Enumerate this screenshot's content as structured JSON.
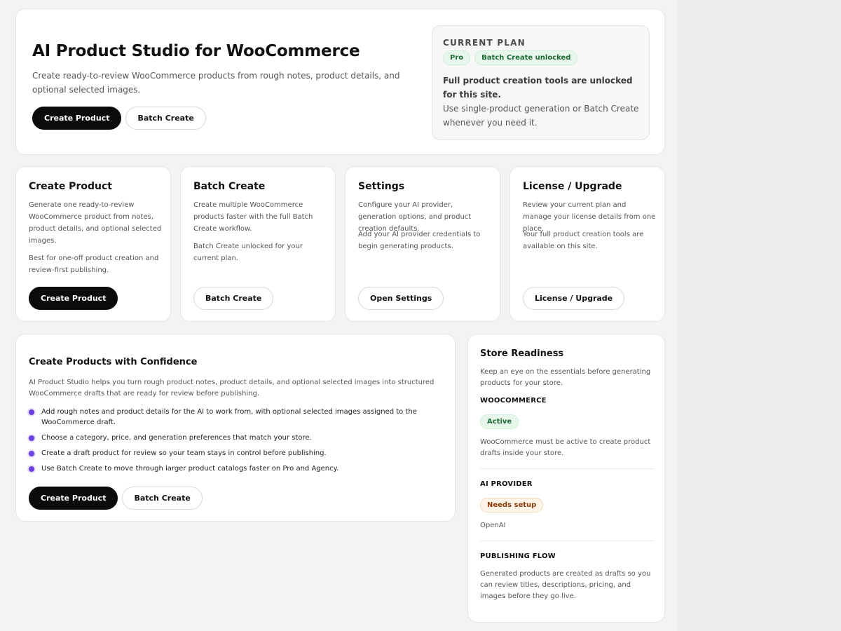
{
  "hero": {
    "title": "AI Product Studio for WooCommerce",
    "description": "Create ready-to-review WooCommerce products from rough notes, product details, and optional selected images.",
    "primary_label": "Create Product",
    "secondary_label": "Batch Create"
  },
  "plan": {
    "label": "CURRENT PLAN",
    "badges": [
      "Pro",
      "Batch Create unlocked"
    ],
    "headline": "Full product creation tools are unlocked for this site.",
    "text": "Use single-product generation or Batch Create whenever you need it."
  },
  "cards": [
    {
      "title": "Create Product",
      "description": "Generate one ready-to-review WooCommerce product from notes, product details, and optional selected images.",
      "note": "Best for one-off product creation and review-first publishing.",
      "button": "Create Product"
    },
    {
      "title": "Batch Create",
      "description": "Create multiple WooCommerce products faster with the full Batch Create workflow.",
      "note": "Batch Create unlocked for your current plan.",
      "button": "Batch Create"
    },
    {
      "title": "Settings",
      "description": "Configure your AI provider, generation options, and product creation defaults.",
      "note": "Add your AI provider credentials to begin generating products.",
      "button": "Open Settings"
    },
    {
      "title": "License / Upgrade",
      "description": "Review your current plan and manage your license details from one place.",
      "note": "Your full product creation tools are available on this site.",
      "button": "License / Upgrade"
    }
  ],
  "confidence": {
    "title": "Create Products with Confidence",
    "description": "AI Product Studio helps you turn rough product notes, product details, and optional selected images into structured WooCommerce drafts that are ready for review before publishing.",
    "items": [
      "Add rough notes and product details for the AI to work from, with optional selected images assigned to the WooCommerce draft.",
      "Choose a category, price, and generation preferences that match your store.",
      "Create a draft product for review so your team stays in control before publishing.",
      "Use Batch Create to move through larger product catalogs faster on Pro and Agency."
    ],
    "primary_label": "Create Product",
    "secondary_label": "Batch Create"
  },
  "readiness": {
    "title": "Store Readiness",
    "description": "Keep an eye on the essentials before generating products for your store.",
    "woocommerce": {
      "heading": "WOOCOMMERCE",
      "status": "Active",
      "text": "WooCommerce must be active to create product drafts inside your store."
    },
    "ai_provider": {
      "heading": "AI PROVIDER",
      "status": "Needs setup",
      "text": "OpenAI"
    },
    "publishing": {
      "heading": "PUBLISHING FLOW",
      "text": "Generated products are created as drafts so you can review titles, descriptions, pricing, and images before they go live."
    }
  },
  "colors": {
    "accent_dark": "#0b0b0b",
    "bullet": "#6d3fe0",
    "status_active": "#1f6b35",
    "status_warning": "#8a3b0a"
  }
}
